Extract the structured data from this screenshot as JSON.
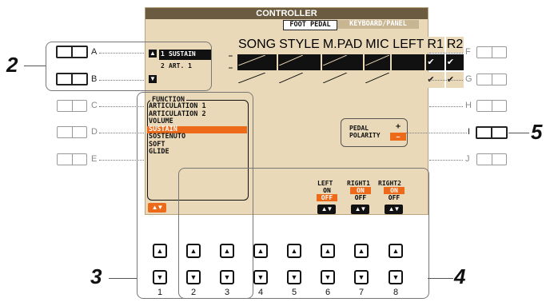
{
  "screen": {
    "title": "CONTROLLER",
    "tabs": {
      "active": "FOOT PEDAL",
      "inactive": "KEYBOARD/PANEL"
    },
    "columns": [
      "SONG",
      "STYLE",
      "M.PAD",
      "MIC",
      "LEFT",
      "R1",
      "R2"
    ],
    "pedals": [
      {
        "number": "1",
        "name": "SUSTAIN",
        "dash": "–",
        "checks": [
          "",
          "",
          "",
          "",
          "",
          "✔",
          "✔"
        ]
      },
      {
        "number": "2",
        "name": "ART. 1",
        "dash": "–",
        "checks": [
          "",
          "",
          "",
          "",
          "",
          "✔",
          "✔"
        ]
      }
    ],
    "function_header": "FUNCTION",
    "function_items": [
      "ARTICULATION 1",
      "ARTICULATION 2",
      "VOLUME",
      "SUSTAIN",
      "SOSTENUTO",
      "SOFT",
      "GLIDE"
    ],
    "function_selected": "SUSTAIN",
    "polarity": {
      "label1": "PEDAL",
      "label2": "POLARITY",
      "plus": "+",
      "minus": "–"
    },
    "parts": [
      {
        "label": "LEFT",
        "on": "ON",
        "off": "OFF",
        "selected": "OFF"
      },
      {
        "label": "RIGHT1",
        "on": "ON",
        "off": "OFF",
        "selected": "ON"
      },
      {
        "label": "RIGHT2",
        "on": "ON",
        "off": "OFF",
        "selected": "ON"
      }
    ],
    "arrows": "▲▼"
  },
  "side_buttons": {
    "left": [
      "A",
      "B",
      "C",
      "D",
      "E"
    ],
    "right": [
      "F",
      "G",
      "H",
      "I",
      "J"
    ]
  },
  "bottom_buttons": {
    "up": "▲",
    "down": "▼",
    "numbers": [
      "1",
      "2",
      "3",
      "4",
      "5",
      "6",
      "7",
      "8"
    ]
  },
  "callouts": {
    "c2": "2",
    "c3": "3",
    "c4": "4",
    "c5": "5"
  },
  "colors": {
    "lcd_bg": "#ead9b8",
    "title_bg": "#6b5b40",
    "accent": "#ee6a1b"
  }
}
